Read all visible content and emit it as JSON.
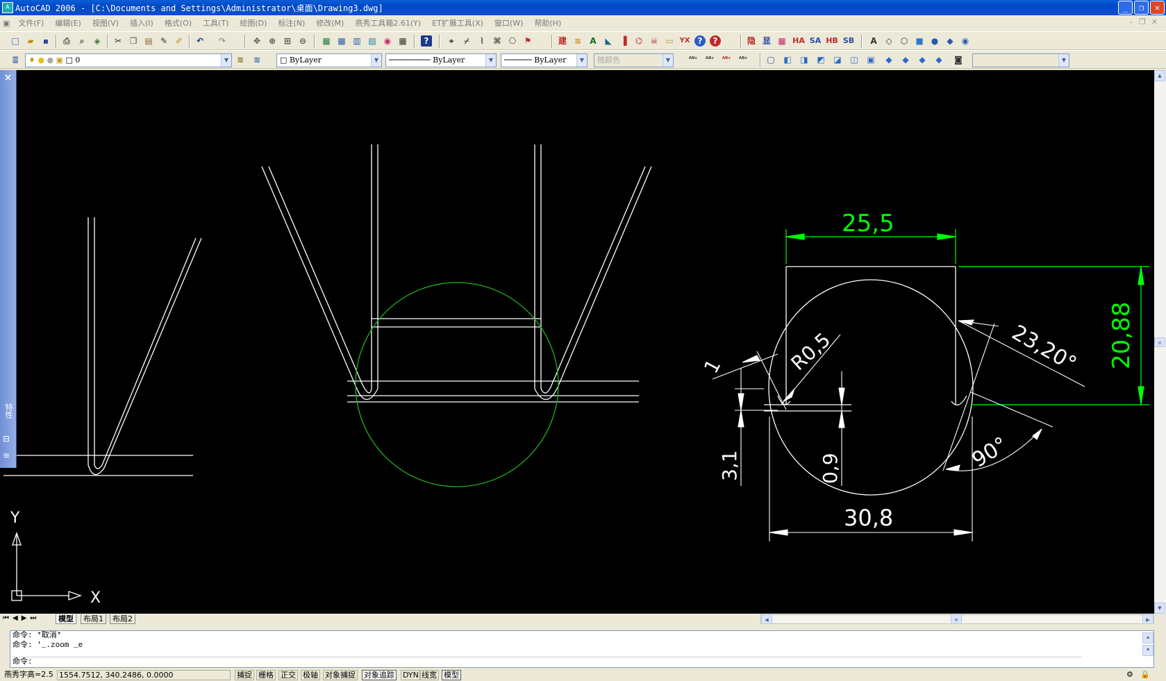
{
  "window": {
    "title": "AutoCAD 2006 - [C:\\Documents and Settings\\Administrator\\桌面\\Drawing3.dwg]",
    "app_icon": "autocad-app-icon",
    "controls": [
      "minimize",
      "restore",
      "close"
    ]
  },
  "menu": [
    "文件(F)",
    "编辑(E)",
    "视图(V)",
    "插入(I)",
    "格式(O)",
    "工具(T)",
    "绘图(D)",
    "标注(N)",
    "修改(M)",
    "燕秀工具箱2.61(Y)",
    "ET扩展工具(X)",
    "窗口(W)",
    "帮助(H)"
  ],
  "layers_toolbar": {
    "layer_value": "0",
    "color_value": "ByLayer",
    "linetype_value": "ByLayer",
    "lineweight_value": "ByLayer",
    "plotstyle_value": "随颜色"
  },
  "toolbar_text_icons": {
    "jian": "建",
    "yx": "YX",
    "yin": "隐",
    "xian": "显",
    "ha": "HA",
    "sa": "SA",
    "hb": "HB",
    "sb": "SB"
  },
  "palette": {
    "label": "特性"
  },
  "drawing": {
    "dims": {
      "top": "25,5",
      "bottom": "30,8",
      "right": "20,88",
      "angle_23": "23,20°",
      "angle_90": "90°",
      "radius": "R0,5",
      "left_1": "1",
      "left_3": "3,1",
      "inner_09": "0,9"
    },
    "ucs": {
      "y": "Y",
      "x": "X"
    },
    "colors": {
      "background": "#000000",
      "geometry": "#ffffff",
      "circle": "#1fb21f",
      "dimension_green": "#00ff00",
      "dimension_white": "#ffffff"
    }
  },
  "tabs": [
    "模型",
    "布局1",
    "布局2"
  ],
  "command_lines": [
    "命令: *取消*",
    "命令: '_.zoom _e",
    "命令:"
  ],
  "status": {
    "text_height": "燕秀字高=2.5",
    "coords": "1554.7512, 340.2486, 0.0000",
    "buttons": [
      "捕捉",
      "栅格",
      "正交",
      "极轴",
      "对象捕捉",
      "对象追踪",
      "DYN",
      "线宽",
      "模型"
    ],
    "active_buttons": [
      "对象追踪",
      "模型"
    ]
  }
}
